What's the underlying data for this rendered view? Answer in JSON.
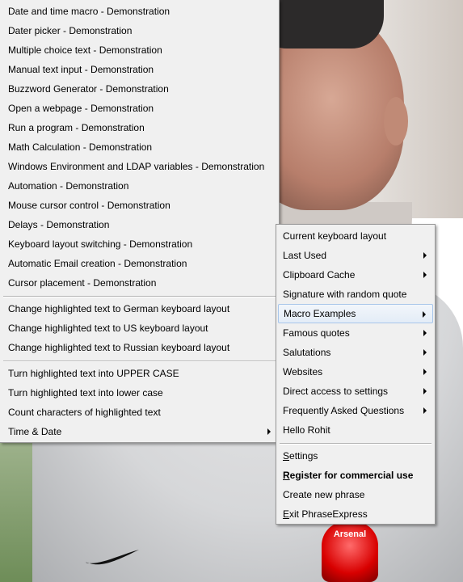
{
  "left_menu": {
    "demo_items": [
      {
        "label": "Date and time macro - Demonstration"
      },
      {
        "label": "Dater picker - Demonstration"
      },
      {
        "label": "Multiple choice text - Demonstration"
      },
      {
        "label": "Manual text input - Demonstration"
      },
      {
        "label": "Buzzword Generator - Demonstration"
      },
      {
        "label": "Open a webpage - Demonstration"
      },
      {
        "label": "Run a program - Demonstration"
      },
      {
        "label": "Math Calculation - Demonstration"
      },
      {
        "label": "Windows Environment and LDAP variables - Demonstration"
      },
      {
        "label": "Automation - Demonstration"
      },
      {
        "label": "Mouse cursor control - Demonstration"
      },
      {
        "label": "Delays - Demonstration"
      },
      {
        "label": "Keyboard layout switching - Demonstration"
      },
      {
        "label": "Automatic Email creation - Demonstration"
      },
      {
        "label": "Cursor placement - Demonstration"
      }
    ],
    "keyboard_items": [
      {
        "label": "Change highlighted text to German keyboard layout"
      },
      {
        "label": "Change highlighted text to US keyboard layout"
      },
      {
        "label": "Change highlighted text to Russian keyboard layout"
      }
    ],
    "text_items": [
      {
        "label": "Turn highlighted text into UPPER CASE"
      },
      {
        "label": "Turn highlighted text into lower case"
      },
      {
        "label": "Count characters of highlighted text"
      },
      {
        "label": "Time & Date"
      }
    ]
  },
  "right_menu": {
    "main_items": [
      {
        "label": "Current keyboard layout"
      },
      {
        "label": "Last Used"
      },
      {
        "label": "Clipboard Cache"
      },
      {
        "label": "Signature with random quote"
      },
      {
        "label": "Macro Examples"
      },
      {
        "label": "Famous quotes"
      },
      {
        "label": "Salutations"
      },
      {
        "label": "Websites"
      },
      {
        "label": "Direct access to settings"
      },
      {
        "label": "Frequently Asked Questions"
      },
      {
        "label": "Hello Rohit"
      }
    ],
    "app_items": {
      "settings_first": "S",
      "settings_rest": "ettings",
      "register_first": "R",
      "register_rest": "egister for commercial use",
      "create_phrase": "Create new phrase",
      "exit_first": "E",
      "exit_rest": "xit PhraseExpress"
    }
  },
  "background": {
    "badge_text": "Arsenal"
  },
  "colors": {
    "menu_bg": "#f0f0f0",
    "highlight_border": "#a8c6ea",
    "highlight_bg": "#e3ecf7"
  }
}
